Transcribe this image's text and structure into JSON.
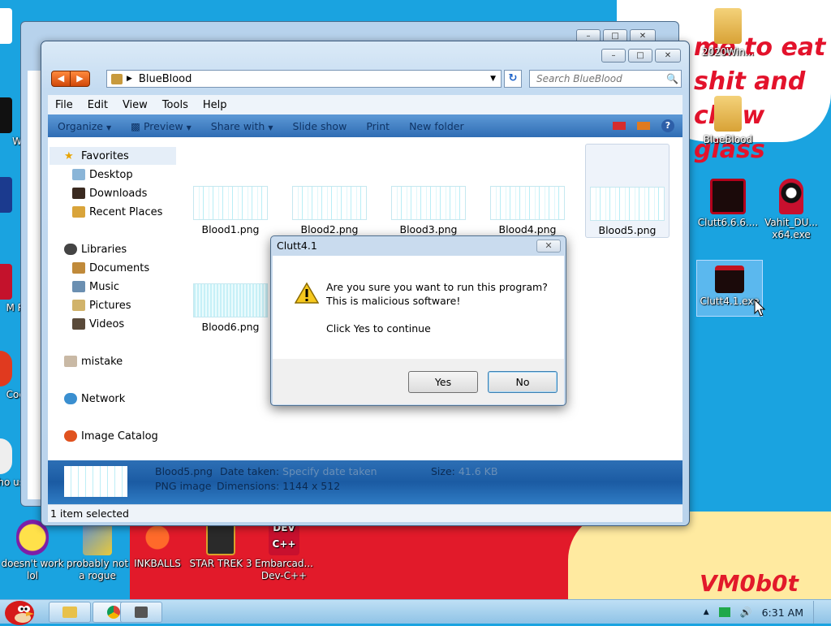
{
  "desktop": {
    "wallpaper_text": "me to eat shit and chew glass",
    "signature": "VM0b0t",
    "icons_right": [
      {
        "label": "2020Win...",
        "name": "folder-2020win-icon"
      },
      {
        "label": "BlueBlood",
        "name": "folder-blueblood-icon"
      },
      {
        "label": "Clutt6.6.6....",
        "name": "clutt666-icon"
      },
      {
        "label": "Vahit_DU... x64.exe",
        "name": "vahit-icon"
      },
      {
        "label": "Clutt4.1.exe",
        "name": "clutt41-icon"
      }
    ],
    "icons_bottom": [
      {
        "label": "doesn't work lol",
        "name": "yahoo-icon"
      },
      {
        "label": "probably not a rogue",
        "name": "rogue-icon"
      },
      {
        "label": "INKBALLS",
        "name": "inkballs-icon"
      },
      {
        "label": "STAR TREK 3",
        "name": "star-trek-icon"
      },
      {
        "label": "Embarcad... Dev-C++",
        "name": "devcpp-icon"
      }
    ],
    "icons_left_partial": [
      "Wi",
      "I",
      "M R",
      "Coc",
      "who us"
    ]
  },
  "explorer": {
    "path": "BlueBlood",
    "search_placeholder": "Search BlueBlood",
    "menu": [
      "File",
      "Edit",
      "View",
      "Tools",
      "Help"
    ],
    "toolbar": [
      "Organize",
      "Preview",
      "Share with",
      "Slide show",
      "Print",
      "New folder"
    ],
    "nav": {
      "favorites": "Favorites",
      "desktop": "Desktop",
      "downloads": "Downloads",
      "recent": "Recent Places",
      "libraries": "Libraries",
      "documents": "Documents",
      "music": "Music",
      "pictures": "Pictures",
      "videos": "Videos",
      "mistake": "mistake",
      "network": "Network",
      "catalog": "Image Catalog"
    },
    "files": [
      "Blood1.png",
      "Blood2.png",
      "Blood3.png",
      "Blood4.png",
      "Blood5.png",
      "Blood6.png"
    ],
    "details": {
      "name": "Blood5.png",
      "type": "PNG image",
      "date_label": "Date taken:",
      "date_value": "Specify date taken",
      "dim_label": "Dimensions:",
      "dim_value": "1144 x 512",
      "size_label": "Size:",
      "size_value": "41.6 KB"
    },
    "status": "1 item selected"
  },
  "dialog": {
    "title": "Clutt4.1",
    "line1": "Are you sure you want to run this program?",
    "line2": "This is malicious software!",
    "line3": "Click Yes to continue",
    "yes": "Yes",
    "no": "No"
  },
  "taskbar": {
    "clock": "6:31 AM"
  }
}
